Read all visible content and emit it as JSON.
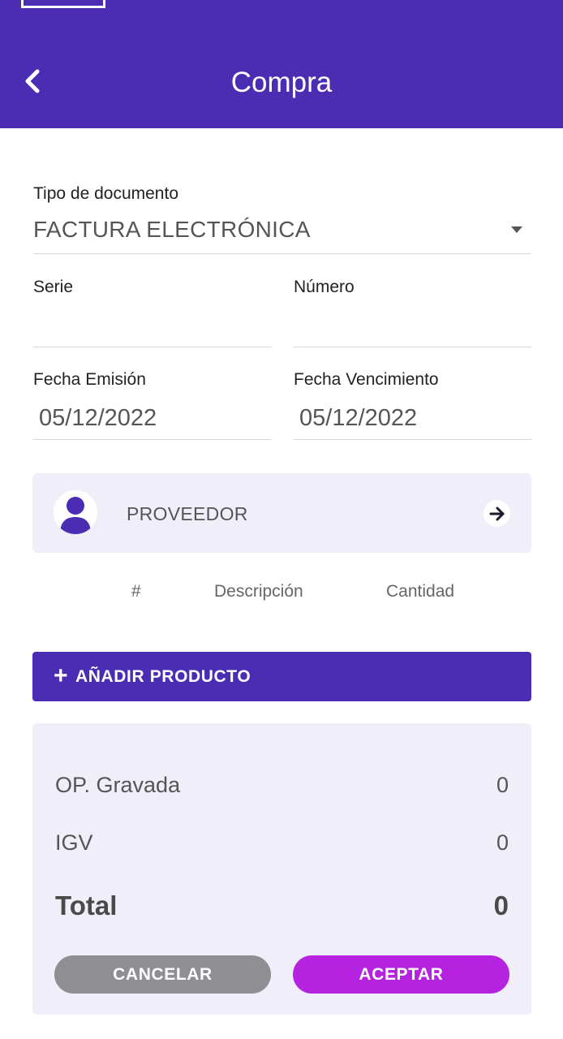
{
  "header": {
    "title": "Compra",
    "back_icon": "chevron-left-icon",
    "background": "#4a2db2"
  },
  "form": {
    "document_type": {
      "label": "Tipo de documento",
      "value": "FACTURA ELECTRÓNICA",
      "icon": "dropdown-arrow-icon"
    },
    "serie": {
      "label": "Serie",
      "value": ""
    },
    "numero": {
      "label": "Número",
      "value": ""
    },
    "fecha_emision": {
      "label": "Fecha Emisión",
      "value": "05/12/2022"
    },
    "fecha_vencimiento": {
      "label": "Fecha Vencimiento",
      "value": "05/12/2022"
    }
  },
  "proveedor": {
    "label": "PROVEEDOR",
    "avatar_icon": "person-icon",
    "arrow_icon": "arrow-right-icon"
  },
  "products_table": {
    "columns": [
      "#",
      "Descripción",
      "Cantidad"
    ],
    "rows": []
  },
  "add_product": {
    "icon": "plus-icon",
    "label": "AÑADIR PRODUCTO"
  },
  "totals": {
    "op_gravada": {
      "label": "OP. Gravada",
      "value": "0"
    },
    "igv": {
      "label": "IGV",
      "value": "0"
    },
    "total": {
      "label": "Total",
      "value": "0"
    }
  },
  "actions": {
    "cancel_label": "CANCELAR",
    "accept_label": "ACEPTAR",
    "cancel_color": "#8e8e93",
    "accept_color": "#b523e0"
  },
  "colors": {
    "primary": "#4a2db2",
    "card_bg": "#f0eef8"
  }
}
